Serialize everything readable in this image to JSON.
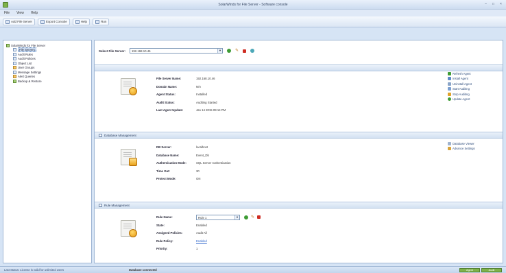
{
  "window": {
    "title": "SolarWinds for File Server - Software console"
  },
  "menu": [
    "File",
    "View",
    "Help"
  ],
  "toolbar": [
    "Add File Server",
    "Export Console",
    "Help",
    "Run"
  ],
  "tree": {
    "root": "SolarWinds for File Server",
    "items": [
      "File Servers",
      "Audit Rules",
      "Audit Policies",
      "Object List",
      "User Groups",
      "Message Settings",
      "Alert Queries",
      "Backup & Restore"
    ]
  },
  "selector": {
    "label": "Select File Server:",
    "value": "192.168.10.46"
  },
  "server": {
    "rows": [
      {
        "k": "File Server Name:",
        "v": "192.168.10.46"
      },
      {
        "k": "Domain Name:",
        "v": "N/A"
      },
      {
        "k": "Agent Status:",
        "v": "Installed"
      },
      {
        "k": "Audit Status:",
        "v": "Auditing Started"
      },
      {
        "k": "Last Agent Update:",
        "v": "Jan 14 2015 09:14 PM"
      }
    ],
    "actions": [
      "Refresh Agent",
      "Install Agent",
      "Uninstall Agent",
      "Start Auditing",
      "Stop Auditing",
      "Update Agent"
    ]
  },
  "db_section": {
    "title": "Database Management",
    "rows": [
      {
        "k": "DB Server:",
        "v": "localhost"
      },
      {
        "k": "Database Name:",
        "v": "Event_Db"
      },
      {
        "k": "Authentication Mode:",
        "v": "SQL Server Authentication"
      },
      {
        "k": "Time Out:",
        "v": "30"
      },
      {
        "k": "Protect Mode:",
        "v": "ON"
      }
    ],
    "actions": [
      "Database Viewer",
      "Advance Settings"
    ]
  },
  "rule_section": {
    "title": "Rule Management",
    "rows": [
      {
        "k": "Rule Name:",
        "v": "Rule 1"
      },
      {
        "k": "State:",
        "v": "Enabled"
      },
      {
        "k": "Assigned Policies:",
        "v": "Audit All"
      },
      {
        "k": "Rule Policy:",
        "v": "Enabled"
      },
      {
        "k": "Priority:",
        "v": "1"
      }
    ]
  },
  "status": {
    "left": "Last Status: License is valid for unlimited users",
    "middle": "Database connected",
    "right": [
      "Agent",
      "Audit"
    ]
  },
  "colors": {
    "accent": "#7fb24a",
    "bg": "#d6e4f5",
    "link": "#2a62c9"
  }
}
